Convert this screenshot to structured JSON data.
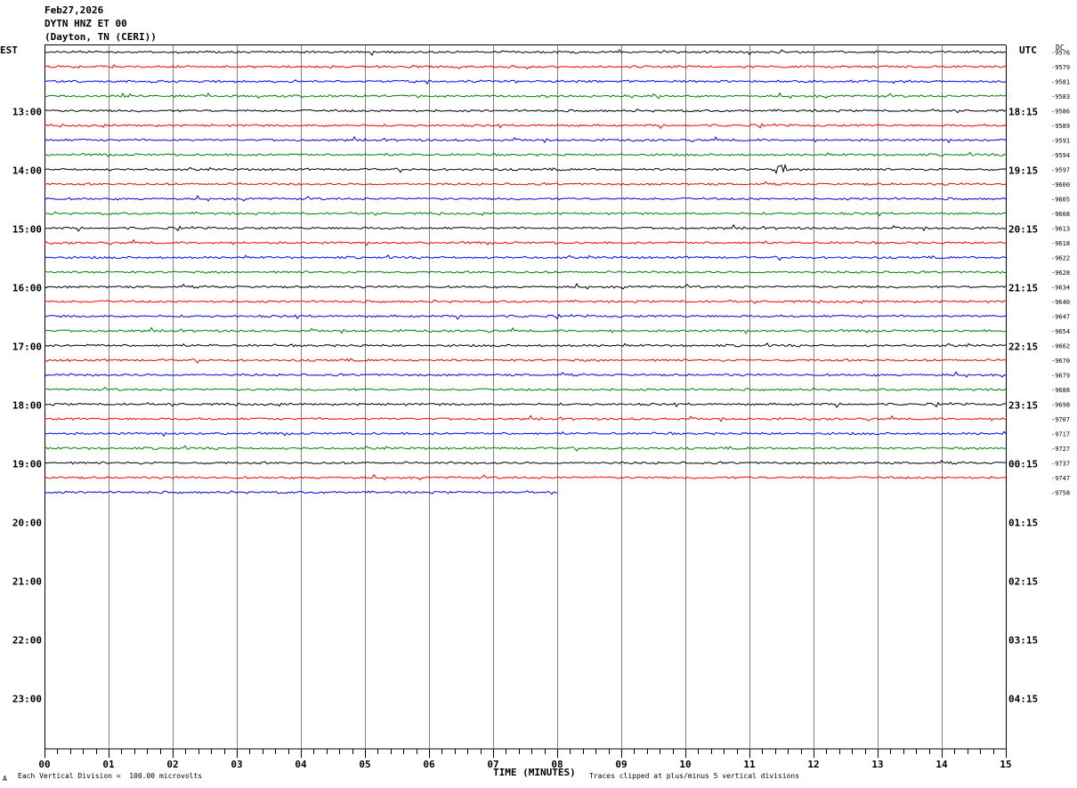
{
  "header": {
    "date": "Feb27,2026",
    "station": "DYTN HNZ ET 00",
    "location": "(Dayton, TN (CERI))"
  },
  "left_axis_label": "EST",
  "right_axis_label": "UTC",
  "dc_label": "DC",
  "footer": {
    "mark": "A",
    "scale_note": "Each Vertical Division =  100.00 microvolts",
    "x_title": "TIME (MINUTES)",
    "clip_note": "Traces clipped at plus/minus 5 vertical divisions"
  },
  "colors": {
    "trace_cycle": [
      "#000000",
      "#ff0000",
      "#0000ff",
      "#008000"
    ],
    "grid": "#808080"
  },
  "chart_data": {
    "type": "helicorder",
    "x_ticks": [
      "00",
      "01",
      "02",
      "03",
      "04",
      "05",
      "06",
      "07",
      "08",
      "09",
      "10",
      "11",
      "12",
      "13",
      "14",
      "15"
    ],
    "xlim": [
      0,
      15
    ],
    "rows_total": 48,
    "rows_with_data": 31,
    "last_row_end_minute": 8,
    "left_hour_labels": [
      {
        "row": 4,
        "label": "13:00"
      },
      {
        "row": 8,
        "label": "14:00"
      },
      {
        "row": 12,
        "label": "15:00"
      },
      {
        "row": 16,
        "label": "16:00"
      },
      {
        "row": 20,
        "label": "17:00"
      },
      {
        "row": 24,
        "label": "18:00"
      },
      {
        "row": 28,
        "label": "19:00"
      },
      {
        "row": 32,
        "label": "20:00"
      },
      {
        "row": 36,
        "label": "21:00"
      },
      {
        "row": 40,
        "label": "22:00"
      },
      {
        "row": 44,
        "label": "23:00"
      }
    ],
    "right_hour_labels": [
      {
        "row": 4,
        "label": "18:15"
      },
      {
        "row": 8,
        "label": "19:15"
      },
      {
        "row": 12,
        "label": "20:15"
      },
      {
        "row": 16,
        "label": "21:15"
      },
      {
        "row": 20,
        "label": "22:15"
      },
      {
        "row": 24,
        "label": "23:15"
      },
      {
        "row": 28,
        "label": "00:15"
      },
      {
        "row": 32,
        "label": "01:15"
      },
      {
        "row": 36,
        "label": "02:15"
      },
      {
        "row": 40,
        "label": "03:15"
      },
      {
        "row": 44,
        "label": "04:15"
      }
    ],
    "dc_offsets": [
      "-9576",
      "-9579",
      "-9581",
      "-9583",
      "-9586",
      "-9589",
      "-9591",
      "-9594",
      "-9597",
      "-9600",
      "-9605",
      "-9608",
      "-9613",
      "-9618",
      "-9622",
      "-9628",
      "-9634",
      "-9640",
      "-9647",
      "-9654",
      "-9662",
      "-9670",
      "-9679",
      "-9688",
      "-9698",
      "-9707",
      "-9717",
      "-9727",
      "-9737",
      "-9747",
      "-9758"
    ],
    "event": {
      "row": 8,
      "minute": 11.45
    }
  }
}
